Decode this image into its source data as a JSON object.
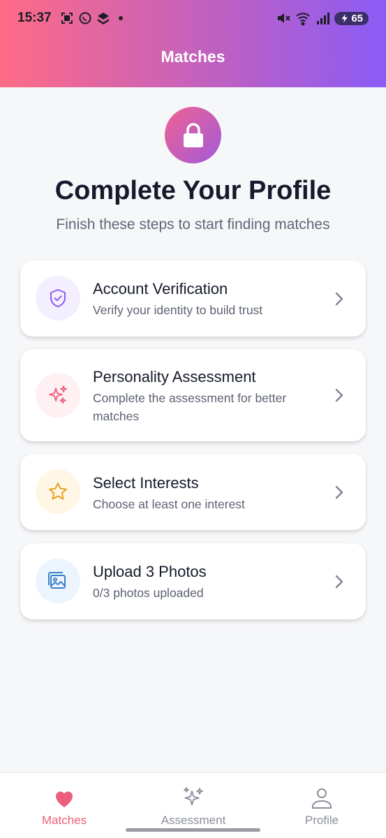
{
  "status_bar": {
    "time": "15:37",
    "battery": "65"
  },
  "header": {
    "title": "Matches"
  },
  "hero": {
    "icon": "lock-icon",
    "title": "Complete Your Profile",
    "subtitle": "Finish these steps to start finding matches"
  },
  "steps": [
    {
      "title": "Account Verification",
      "description": "Verify your identity to build trust",
      "icon": "shield-check-icon",
      "icon_color": "#8b5cf6",
      "icon_bg": "#f3efff"
    },
    {
      "title": "Personality Assessment",
      "description": "Complete the assessment for better matches",
      "icon": "sparkles-icon",
      "icon_color": "#ec5f7c",
      "icon_bg": "#fff0f3"
    },
    {
      "title": "Select Interests",
      "description": "Choose at least one interest",
      "icon": "star-icon",
      "icon_color": "#e5a31d",
      "icon_bg": "#fff6e6"
    },
    {
      "title": "Upload 3 Photos",
      "description": "0/3 photos uploaded",
      "icon": "image-icon",
      "icon_color": "#3b82c4",
      "icon_bg": "#ecf4ff"
    }
  ],
  "bottom_nav": [
    {
      "label": "Matches",
      "icon": "heart-icon",
      "active": true
    },
    {
      "label": "Assessment",
      "icon": "sparkles-icon",
      "active": false
    },
    {
      "label": "Profile",
      "icon": "person-icon",
      "active": false
    }
  ],
  "colors": {
    "accent": "#ec5f7c",
    "gradient_start": "#ff6b86",
    "gradient_end": "#8b5cf6"
  }
}
